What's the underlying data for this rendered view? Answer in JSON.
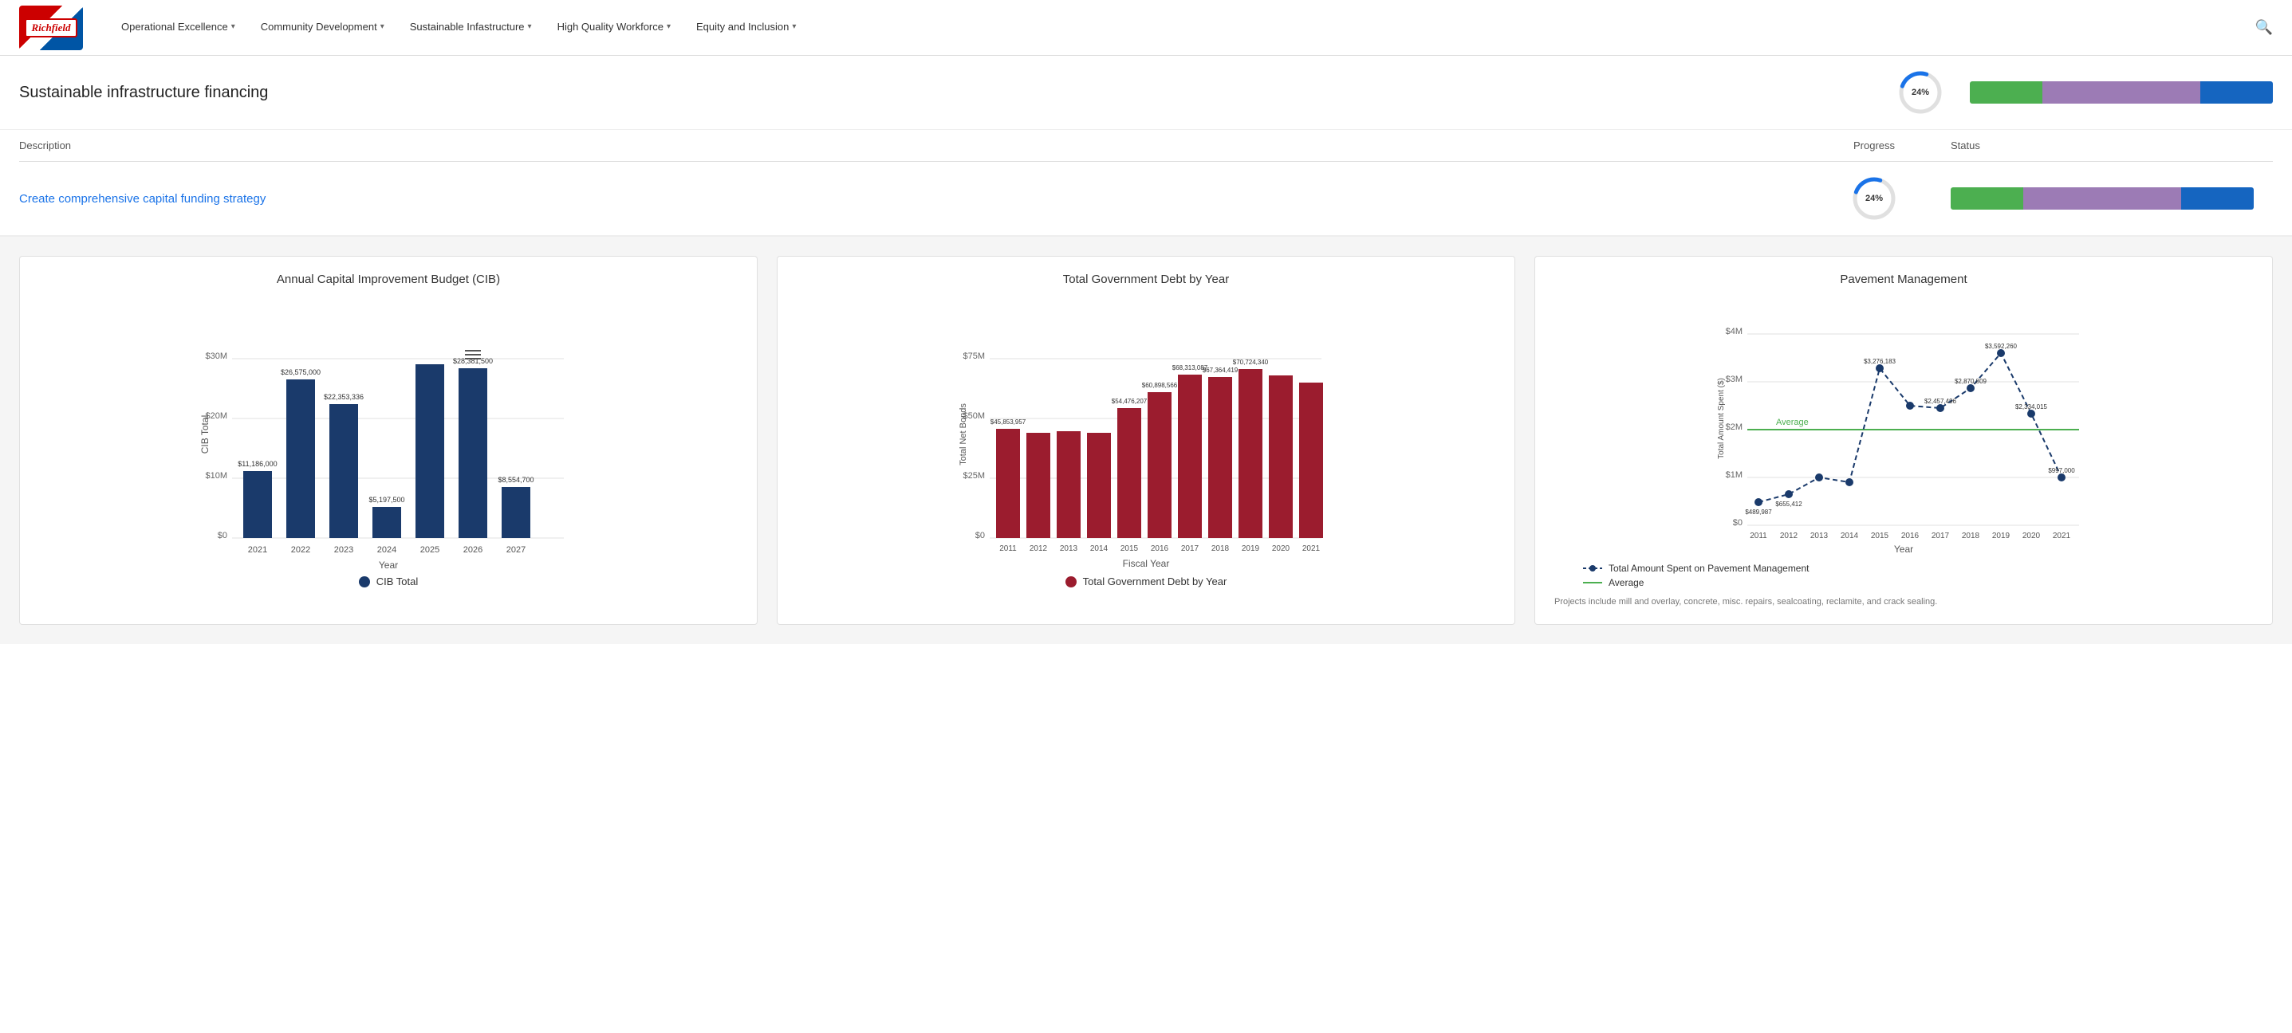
{
  "nav": {
    "logo_text": "Richfield",
    "items": [
      {
        "label": "Operational Excellence",
        "chevron": "▾"
      },
      {
        "label": "Community Development",
        "chevron": "▾"
      },
      {
        "label": "Sustainable Infastructure",
        "chevron": "▾"
      },
      {
        "label": "High Quality Workforce",
        "chevron": "▾"
      },
      {
        "label": "Equity and Inclusion",
        "chevron": "▾"
      }
    ]
  },
  "section": {
    "title": "Sustainable infrastructure financing",
    "progress_pct": "24%"
  },
  "table": {
    "headers": {
      "description": "Description",
      "progress": "Progress",
      "status": "Status"
    },
    "rows": [
      {
        "description": "Create comprehensive capital funding strategy",
        "progress_pct": "24%"
      }
    ]
  },
  "charts": {
    "cib": {
      "title": "Annual Capital Improvement Budget (CIB)",
      "y_axis_label": "CIB Total",
      "x_axis_label": "Year",
      "legend": "CIB Total",
      "bars": [
        {
          "year": "2021",
          "value": 11186000,
          "label": "$11,186,000"
        },
        {
          "year": "2022",
          "value": 26575000,
          "label": "$26,575,000"
        },
        {
          "year": "2023",
          "value": 22353336,
          "label": "$22,353,336"
        },
        {
          "year": "2024",
          "value": 5197500,
          "label": "$5,197,500"
        },
        {
          "year": "2025",
          "value": 29000000,
          "label": ""
        },
        {
          "year": "2026",
          "value": 28381500,
          "label": "$28,381,500"
        },
        {
          "year": "2027",
          "value": 8554700,
          "label": "$8,554,700"
        }
      ],
      "y_ticks": [
        "$0",
        "$10M",
        "$20M",
        "$30M"
      ]
    },
    "debt": {
      "title": "Total Government Debt by Year",
      "y_axis_label": "Total Net Bonds",
      "x_axis_label": "Fiscal Year",
      "legend": "Total Government Debt by Year",
      "bars": [
        {
          "year": "2011",
          "value": 45853957,
          "label": "$45,853,957"
        },
        {
          "year": "2012",
          "value": 44000000,
          "label": ""
        },
        {
          "year": "2013",
          "value": 44500000,
          "label": ""
        },
        {
          "year": "2014",
          "value": 44000000,
          "label": ""
        },
        {
          "year": "2015",
          "value": 54476207,
          "label": "$54,476,207"
        },
        {
          "year": "2016",
          "value": 60898566,
          "label": "$60,898,566"
        },
        {
          "year": "2017",
          "value": 68313087,
          "label": "$68,313,087"
        },
        {
          "year": "2018",
          "value": 67364419,
          "label": "$67,364,419"
        },
        {
          "year": "2019",
          "value": 70724340,
          "label": "$70,724,340"
        },
        {
          "year": "2020",
          "value": 68000000,
          "label": ""
        },
        {
          "year": "2021",
          "value": 65000000,
          "label": ""
        }
      ],
      "y_ticks": [
        "$0",
        "$25M",
        "$50M",
        "$75M"
      ]
    },
    "pavement": {
      "title": "Pavement Management",
      "y_axis_label": "Total Amount Spent ($)",
      "x_axis_label": "Year",
      "legend_line": "Total Amount Spent on Pavement Management",
      "legend_avg": "Average",
      "avg_value": 2000000,
      "avg_label": "Average",
      "points": [
        {
          "year": "2011",
          "value": 489987,
          "label": "$489,987"
        },
        {
          "year": "2012",
          "value": 655412,
          "label": "$655,412"
        },
        {
          "year": "2013",
          "value": 1000000,
          "label": ""
        },
        {
          "year": "2014",
          "value": 900000,
          "label": ""
        },
        {
          "year": "2015",
          "value": 3276183,
          "label": "$3,276,183"
        },
        {
          "year": "2016",
          "value": 2500000,
          "label": ""
        },
        {
          "year": "2017",
          "value": 2457496,
          "label": "$2,457,496"
        },
        {
          "year": "2018",
          "value": 2870809,
          "label": "$2,870,809"
        },
        {
          "year": "2019",
          "value": 3592260,
          "label": "$3,592,260"
        },
        {
          "year": "2020",
          "value": 2334015,
          "label": "$2,334,015"
        },
        {
          "year": "2021",
          "value": 997000,
          "label": "$997,000"
        }
      ],
      "y_ticks": [
        "$0",
        "$1M",
        "$2M",
        "$3M",
        "$4M"
      ],
      "note": "Projects include mill and overlay, concrete, misc. repairs, sealcoating, reclamite, and crack sealing."
    }
  }
}
